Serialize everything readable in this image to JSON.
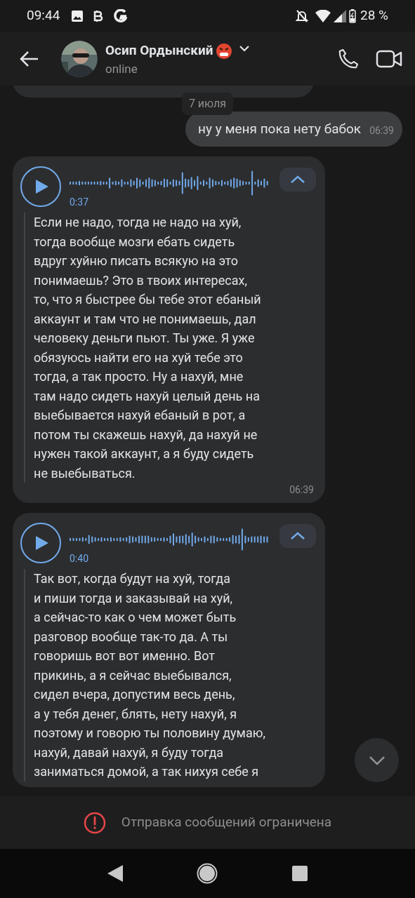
{
  "status_bar": {
    "time": "09:44",
    "battery": "28 %"
  },
  "header": {
    "name": "Осип Ордынский",
    "status": "online"
  },
  "messages": [
    {
      "kind": "date",
      "text": "7 июля"
    },
    {
      "kind": "text",
      "outgoing": true,
      "text": "ну у меня пока нету бабок",
      "time": "06:39"
    },
    {
      "kind": "voice",
      "outgoing": false,
      "duration": "0:37",
      "expanded": true,
      "time": "06:39",
      "transcript": [
        "Если не надо, тогда не надо на хуй,",
        "тогда вообще мозги ебать сидеть",
        "вдруг хуйню писать всякую на это",
        "понимаешь? Это в твоих интересах,",
        "то, что я быстрее бы тебе этот ебаный",
        "аккаунт и там что не понимаешь, дал",
        "человеку деньги пьют. Ты уже. Я уже",
        "обязуюсь найти его на хуй тебе это",
        "тогда, а так просто. Ну а нахуй, мне",
        "там надо сидеть нахуй целый день на",
        "выебывается нахуй ебаный в рот, а",
        "потом ты скажешь нахуй, да нахуй не",
        "нужен такой аккаунт, а я буду сидеть",
        "не выебываться."
      ]
    },
    {
      "kind": "voice",
      "outgoing": false,
      "duration": "0:40",
      "expanded": true,
      "transcript": [
        "Так вот, когда будут на хуй, тогда",
        "и пиши тогда и заказывай на хуй,",
        "а сейчас-то как о чем может быть",
        "разговор вообще так-то да. А ты",
        "говоришь вот вот именно. Вот",
        "прикинь, а я сейчас выебывался,",
        "сидел вчера, допустим весь день,",
        "а у тебя денег, блять, нету нахуй, я",
        "поэтому и говорю ты половину думаю,",
        "нахуй, давай нахуй, я буду тогда",
        "заниматься домой, а так нихуя себе я"
      ]
    }
  ],
  "restriction_notice": "Отправка сообщений ограничена"
}
